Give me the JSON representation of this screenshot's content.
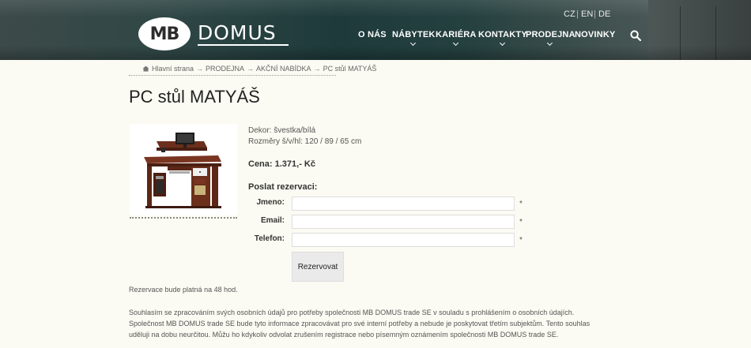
{
  "header": {
    "logo_mark": "MB",
    "logo_text": "DOMUS",
    "languages": [
      "CZ",
      "EN",
      "DE"
    ],
    "nav": [
      "O NÁS",
      "NÁBYTEK",
      "KARIÉRA",
      "KONTAKTY",
      "PRODEJNA",
      "NOVINKY"
    ],
    "search_icon": "search-icon"
  },
  "breadcrumb": [
    "Hlavní strana",
    "PRODEJNA",
    "AKČNÍ NABÍDKA",
    "PC stůl MATYÁŠ"
  ],
  "product": {
    "title": "PC stůl MATYÁŠ",
    "decor": "Dekor: švestka/bílá",
    "dimensions": "Rozměry š/v/hl:  120 / 89 / 65 cm",
    "price": "Cena: 1.371,- Kč"
  },
  "form": {
    "heading": "Poslat rezervaci:",
    "fields": [
      {
        "label": "Jmeno:",
        "value": "",
        "required_mark": "*"
      },
      {
        "label": "Email:",
        "value": "",
        "required_mark": "*"
      },
      {
        "label": "Telefon:",
        "value": "",
        "required_mark": "*"
      }
    ],
    "submit_label": "Rezervovat"
  },
  "note": "Rezervace bude platná na 48 hod.",
  "consent": [
    "Souhlasím se zpracováním svých osobních údajů pro potřeby společnosti MB DOMUS trade SE v souladu s prohlášením o osobních údajích.",
    "Společnost MB DOMUS trade SE bude tyto informace zpracovávat pro své interní potřeby a nebude je poskytovat třetím subjektům. Tento souhlas",
    "uděluji na dobu neurčitou. Můžu ho kdykoliv odvolat zrušením registrace nebo písemným oznámením společnosti MB DOMUS trade SE."
  ]
}
